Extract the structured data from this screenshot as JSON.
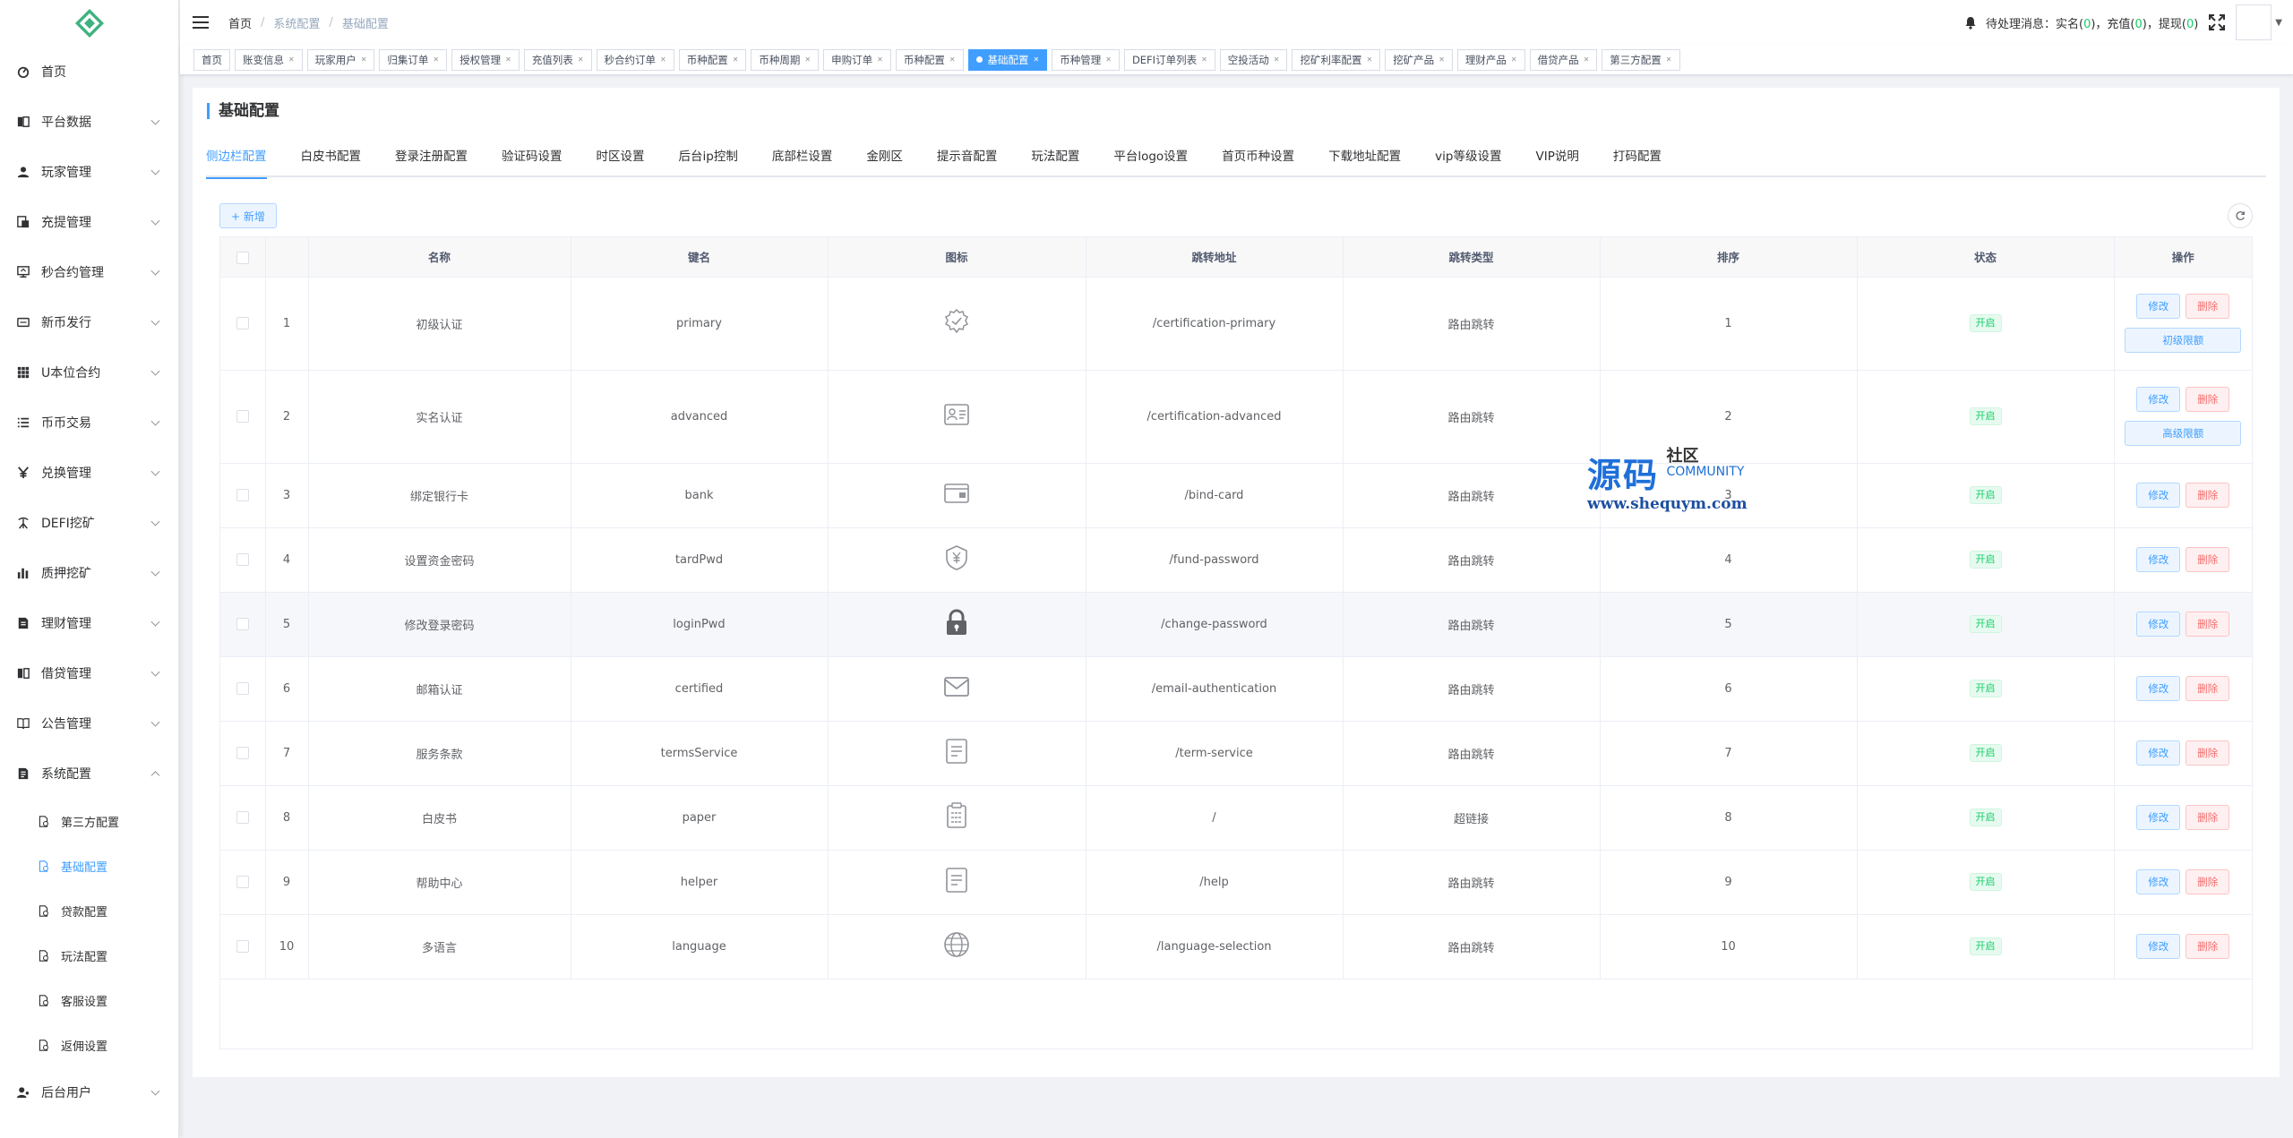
{
  "sidebar": {
    "menu": [
      {
        "label": "首页",
        "icon": "dashboard-icon",
        "arrow": false
      },
      {
        "label": "平台数据",
        "icon": "chart-icon",
        "arrow": true
      },
      {
        "label": "玩家管理",
        "icon": "user-icon",
        "arrow": true
      },
      {
        "label": "充提管理",
        "icon": "wallet-icon",
        "arrow": true
      },
      {
        "label": "秒合约管理",
        "icon": "contract-icon",
        "arrow": true
      },
      {
        "label": "新币发行",
        "icon": "coin-icon",
        "arrow": true
      },
      {
        "label": "U本位合约",
        "icon": "grid-icon",
        "arrow": true
      },
      {
        "label": "币币交易",
        "icon": "list-icon",
        "arrow": true
      },
      {
        "label": "兑换管理",
        "icon": "yen-icon",
        "arrow": true
      },
      {
        "label": "DEFI挖矿",
        "icon": "mining-icon",
        "arrow": true
      },
      {
        "label": "质押挖矿",
        "icon": "bar-chart-icon",
        "arrow": true
      },
      {
        "label": "理财管理",
        "icon": "finance-icon",
        "arrow": true
      },
      {
        "label": "借贷管理",
        "icon": "loan-icon",
        "arrow": true
      },
      {
        "label": "公告管理",
        "icon": "book-icon",
        "arrow": true
      },
      {
        "label": "系统配置",
        "icon": "settings-doc-icon",
        "arrow": true,
        "expanded": true
      }
    ],
    "submenu": [
      {
        "label": "第三方配置",
        "active": false
      },
      {
        "label": "基础配置",
        "active": true
      },
      {
        "label": "贷款配置",
        "active": false
      },
      {
        "label": "玩法配置",
        "active": false
      },
      {
        "label": "客服设置",
        "active": false
      },
      {
        "label": "返佣设置",
        "active": false
      }
    ],
    "after": [
      {
        "label": "后台用户",
        "icon": "admin-user-icon",
        "arrow": true
      }
    ]
  },
  "navbar": {
    "breadcrumb": [
      "首页",
      "系统配置",
      "基础配置"
    ],
    "pending_label": "待处理消息：",
    "realname_label": "实名(",
    "realname_count": "0",
    "realname_close": ")，",
    "recharge_label": "充值(",
    "recharge_count": "0",
    "recharge_close": ")，",
    "withdraw_label": "提现(",
    "withdraw_count": "0",
    "withdraw_close": ")"
  },
  "tags": [
    {
      "label": "首页",
      "closable": false
    },
    {
      "label": "账变信息",
      "closable": true
    },
    {
      "label": "玩家用户",
      "closable": true
    },
    {
      "label": "归集订单",
      "closable": true
    },
    {
      "label": "授权管理",
      "closable": true
    },
    {
      "label": "充值列表",
      "closable": true
    },
    {
      "label": "秒合约订单",
      "closable": true
    },
    {
      "label": "币种配置",
      "closable": true
    },
    {
      "label": "币种周期",
      "closable": true
    },
    {
      "label": "申购订单",
      "closable": true
    },
    {
      "label": "币种配置",
      "closable": true
    },
    {
      "label": "基础配置",
      "closable": true,
      "active": true
    },
    {
      "label": "币种管理",
      "closable": true
    },
    {
      "label": "DEFI订单列表",
      "closable": true
    },
    {
      "label": "空投活动",
      "closable": true
    },
    {
      "label": "挖矿利率配置",
      "closable": true
    },
    {
      "label": "挖矿产品",
      "closable": true
    },
    {
      "label": "理财产品",
      "closable": true
    },
    {
      "label": "借贷产品",
      "closable": true
    },
    {
      "label": "第三方配置",
      "closable": true
    }
  ],
  "page": {
    "title": "基础配置",
    "tabs": [
      "侧边栏配置",
      "白皮书配置",
      "登录注册配置",
      "验证码设置",
      "时区设置",
      "后台ip控制",
      "底部栏设置",
      "金刚区",
      "提示音配置",
      "玩法配置",
      "平台logo设置",
      "首页币种设置",
      "下载地址配置",
      "vip等级设置",
      "VIP说明",
      "打码配置"
    ],
    "active_tab": 0,
    "add_label": "+ 新增"
  },
  "table": {
    "columns": [
      "名称",
      "键名",
      "图标",
      "跳转地址",
      "跳转类型",
      "排序",
      "状态",
      "操作"
    ],
    "edit_label": "修改",
    "delete_label": "删除",
    "rows": [
      {
        "index": "1",
        "name": "初级认证",
        "key": "primary",
        "icon": "badge-check-icon",
        "url": "/certification-primary",
        "type": "路由跳转",
        "sort": "1",
        "status": "开启",
        "extra": "初级限额"
      },
      {
        "index": "2",
        "name": "实名认证",
        "key": "advanced",
        "icon": "id-card-icon",
        "url": "/certification-advanced",
        "type": "路由跳转",
        "sort": "2",
        "status": "开启",
        "extra": "高级限额"
      },
      {
        "index": "3",
        "name": "绑定银行卡",
        "key": "bank",
        "icon": "card-wallet-icon",
        "url": "/bind-card",
        "type": "路由跳转",
        "sort": "3",
        "status": "开启",
        "extra": ""
      },
      {
        "index": "4",
        "name": "设置资金密码",
        "key": "tardPwd",
        "icon": "shield-yen-icon",
        "url": "/fund-password",
        "type": "路由跳转",
        "sort": "4",
        "status": "开启",
        "extra": ""
      },
      {
        "index": "5",
        "name": "修改登录密码",
        "key": "loginPwd",
        "icon": "lock-icon",
        "url": "/change-password",
        "type": "路由跳转",
        "sort": "5",
        "status": "开启",
        "extra": ""
      },
      {
        "index": "6",
        "name": "邮箱认证",
        "key": "certified",
        "icon": "mail-icon",
        "url": "/email-authentication",
        "type": "路由跳转",
        "sort": "6",
        "status": "开启",
        "extra": ""
      },
      {
        "index": "7",
        "name": "服务条款",
        "key": "termsService",
        "icon": "document-icon",
        "url": "/term-service",
        "type": "路由跳转",
        "sort": "7",
        "status": "开启",
        "extra": ""
      },
      {
        "index": "8",
        "name": "白皮书",
        "key": "paper",
        "icon": "clipboard-icon",
        "url": "/",
        "type": "超链接",
        "sort": "8",
        "status": "开启",
        "extra": ""
      },
      {
        "index": "9",
        "name": "帮助中心",
        "key": "helper",
        "icon": "help-doc-icon",
        "url": "/help",
        "type": "路由跳转",
        "sort": "9",
        "status": "开启",
        "extra": ""
      },
      {
        "index": "10",
        "name": "多语言",
        "key": "language",
        "icon": "globe-icon",
        "url": "/language-selection",
        "type": "路由跳转",
        "sort": "10",
        "status": "开启",
        "extra": ""
      }
    ]
  },
  "watermark": {
    "big": "源码",
    "small": "社区",
    "community": "COMMUNITY",
    "url": "www.shequym.com"
  },
  "colors": {
    "primary": "#409eff",
    "success": "#13ce66",
    "danger": "#f56c6c"
  }
}
